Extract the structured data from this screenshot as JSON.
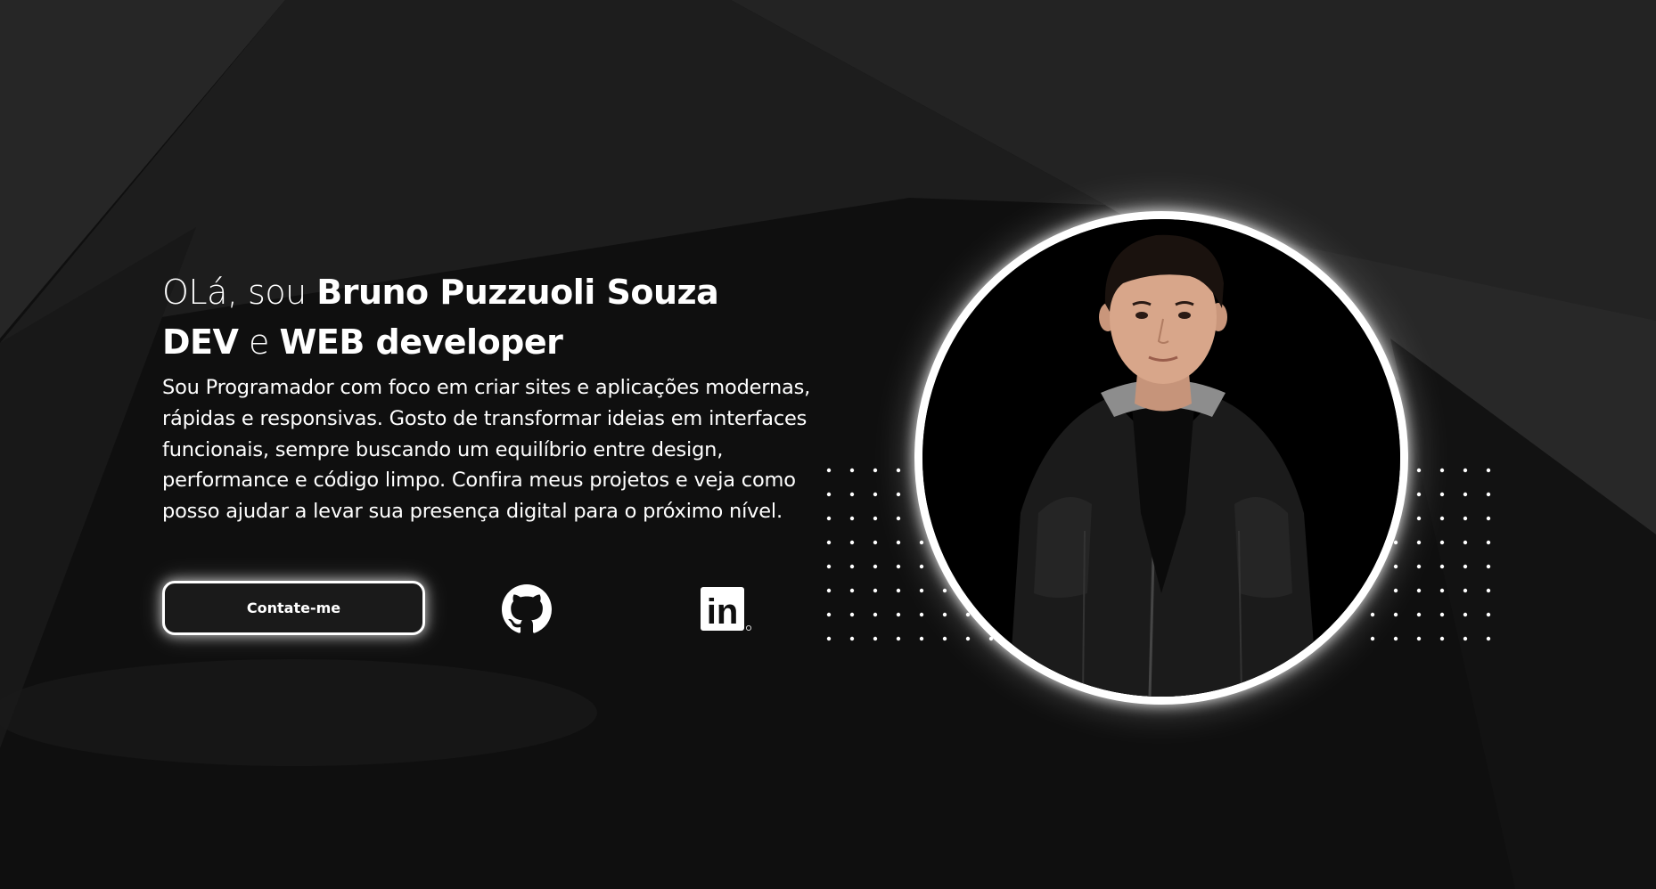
{
  "hero": {
    "greeting": {
      "prefix": "OLá, sou ",
      "name": "Bruno Puzzuoli Souza"
    },
    "role": {
      "part1": "DEV",
      "connector": " e ",
      "part2": "WEB developer"
    },
    "description": "Sou Programador com foco em criar sites e aplicações modernas, rápidas e responsivas. Gosto de transformar ideias em interfaces funcionais, sempre buscando um equilíbrio entre design, performance e código limpo. Confira meus projetos e veja como posso ajudar a levar sua presença digital para o próximo nível.",
    "contact_button_label": "Contate-me"
  },
  "social_links": [
    {
      "icon": "github-icon"
    },
    {
      "icon": "linkedin-icon",
      "logo_text": "in"
    }
  ],
  "colors": {
    "background": "#0f0f0f",
    "accent": "#ffffff"
  }
}
